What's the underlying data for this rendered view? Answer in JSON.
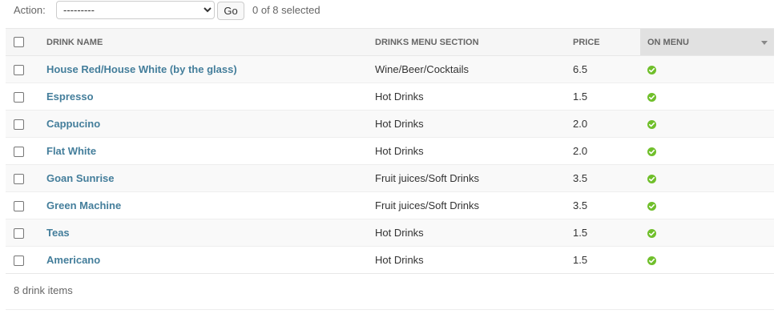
{
  "actions": {
    "label": "Action:",
    "select_value": "---------",
    "go_label": "Go",
    "selected_count": "0 of 8 selected"
  },
  "table": {
    "columns": {
      "name": "DRINK NAME",
      "section": "DRINKS MENU SECTION",
      "price": "PRICE",
      "on_menu": "ON MENU"
    },
    "rows": [
      {
        "name": "House Red/House White (by the glass)",
        "section": "Wine/Beer/Cocktails",
        "price": "6.5",
        "on_menu": "yes-icon"
      },
      {
        "name": "Espresso",
        "section": "Hot Drinks",
        "price": "1.5",
        "on_menu": "yes-icon"
      },
      {
        "name": "Cappucino",
        "section": "Hot Drinks",
        "price": "2.0",
        "on_menu": "yes-icon"
      },
      {
        "name": "Flat White",
        "section": "Hot Drinks",
        "price": "2.0",
        "on_menu": "yes-icon"
      },
      {
        "name": "Goan Sunrise",
        "section": "Fruit juices/Soft Drinks",
        "price": "3.5",
        "on_menu": "yes-icon"
      },
      {
        "name": "Green Machine",
        "section": "Fruit juices/Soft Drinks",
        "price": "3.5",
        "on_menu": "yes-icon"
      },
      {
        "name": "Teas",
        "section": "Hot Drinks",
        "price": "1.5",
        "on_menu": "yes-icon"
      },
      {
        "name": "Americano",
        "section": "Hot Drinks",
        "price": "1.5",
        "on_menu": "yes-icon"
      }
    ]
  },
  "paginator": {
    "text": "8 drink items"
  },
  "colors": {
    "link": "#447e9b",
    "yes_icon": "#70bf2b",
    "sorted_header": "#e1e1e1"
  }
}
